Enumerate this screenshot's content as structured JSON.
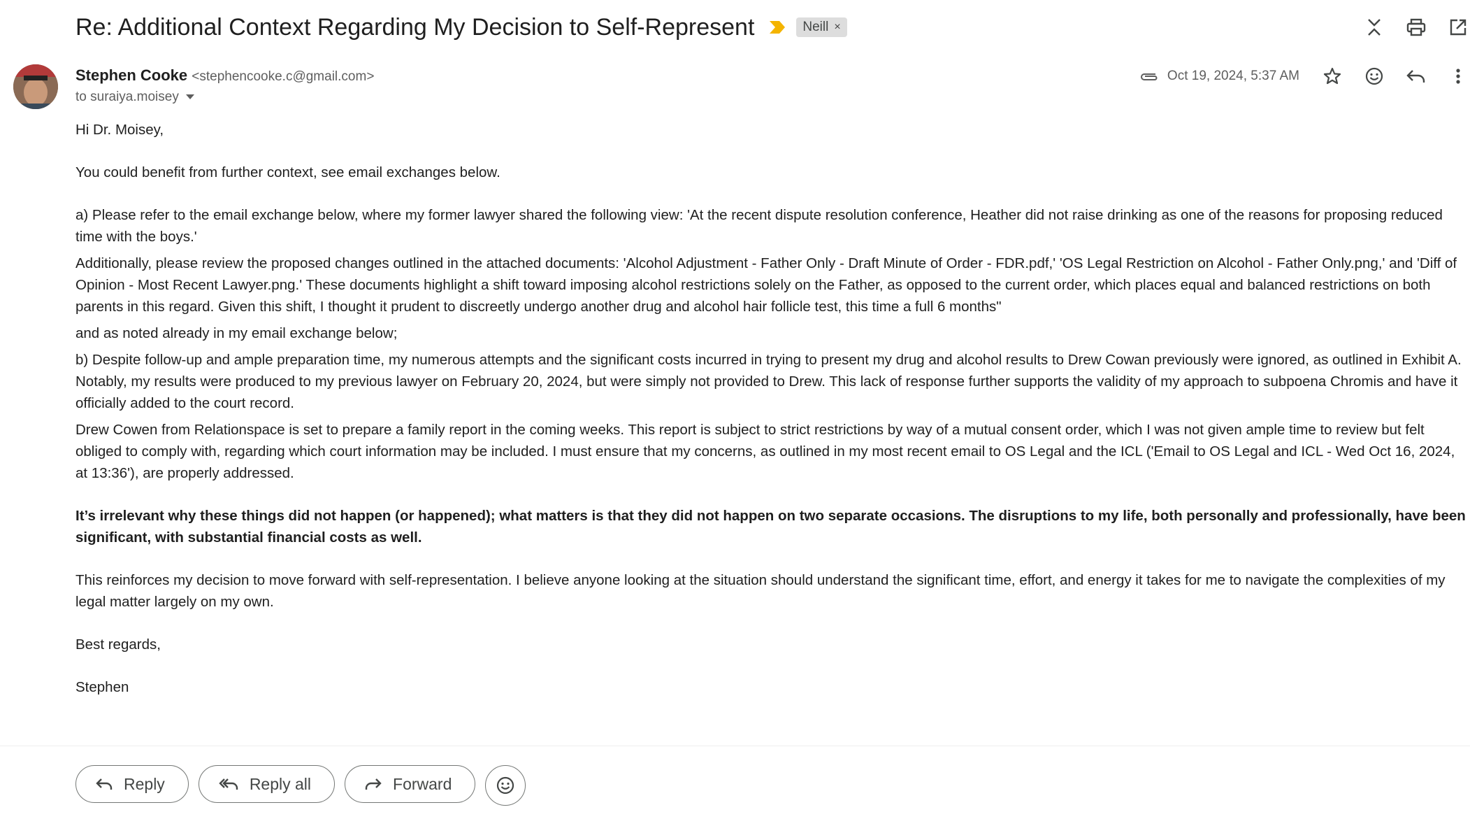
{
  "email": {
    "subject": "Re: Additional Context Regarding My Decision to Self-Represent",
    "label": "Neill",
    "label_close": "×",
    "sender_name": "Stephen Cooke",
    "sender_email": "<stephencooke.c@gmail.com>",
    "to": "to suraiya.moisey",
    "date": "Oct 19, 2024, 5:37 AM",
    "body": {
      "greeting": "Hi Dr. Moisey,",
      "p1": "You could benefit from further context, see email exchanges below.",
      "p2": "a)  Please refer to the email exchange below, where my former lawyer shared the following view: 'At the recent dispute resolution conference, Heather did not raise drinking as one of the reasons for proposing reduced time with the boys.'",
      "p3": "Additionally, please review the proposed changes outlined in the attached documents: 'Alcohol Adjustment - Father Only - Draft Minute of Order - FDR.pdf,' 'OS Legal Restriction on Alcohol - Father Only.png,' and 'Diff of Opinion - Most Recent Lawyer.png.' These documents highlight a shift toward imposing alcohol restrictions solely on the Father, as opposed to the current order, which places equal and balanced restrictions on both parents in this regard. Given this shift, I thought it prudent to discreetly undergo another drug and alcohol hair follicle test, this time a full 6 months\"",
      "p4": "and as noted already in my email exchange below;",
      "p5": "b) Despite follow-up and ample preparation time, my numerous attempts and the significant costs incurred in trying to present my drug and alcohol results to Drew Cowan previously were ignored, as outlined in Exhibit A. Notably, my results were produced to my previous lawyer on February 20, 2024, but were simply not provided to Drew. This lack of response further supports the validity of my approach to subpoena Chromis and have it officially added to the court record.",
      "p6": "Drew Cowen from Relationspace is set to prepare a family report in the coming weeks. This report is subject to strict restrictions by way of a mutual consent order, which I was not given ample time to review but felt obliged to comply with, regarding which court information may be included. I must ensure that my concerns, as outlined in my most recent email to OS Legal and the ICL ('Email to OS Legal and ICL - Wed Oct 16, 2024, at 13:36'), are properly addressed.",
      "p7_bold": "It’s irrelevant why these things did not happen (or happened); what matters is that they did not happen on two separate occasions. The disruptions to my life, both personally and professionally, have been significant, with substantial financial costs as well.",
      "p8": "This reinforces my decision to move forward with self-representation. I believe anyone looking at the situation should understand the significant time, effort, and energy it takes for me to navigate the complexities of my legal matter largely on my own.",
      "closing": "Best regards,",
      "signature": "Stephen"
    }
  },
  "actions": {
    "reply": "Reply",
    "reply_all": "Reply all",
    "forward": "Forward"
  },
  "icons": {
    "top": [
      "collapse-icon",
      "print-icon",
      "open-new-window-icon"
    ],
    "meta": [
      "attachment-icon",
      "star-icon",
      "emoji-icon",
      "reply-icon",
      "more-vert-icon"
    ]
  },
  "colors": {
    "importance": "#f4b400",
    "text": "#1f1f1f",
    "muted": "#5e5e5e",
    "chip_bg": "#dddddd"
  }
}
